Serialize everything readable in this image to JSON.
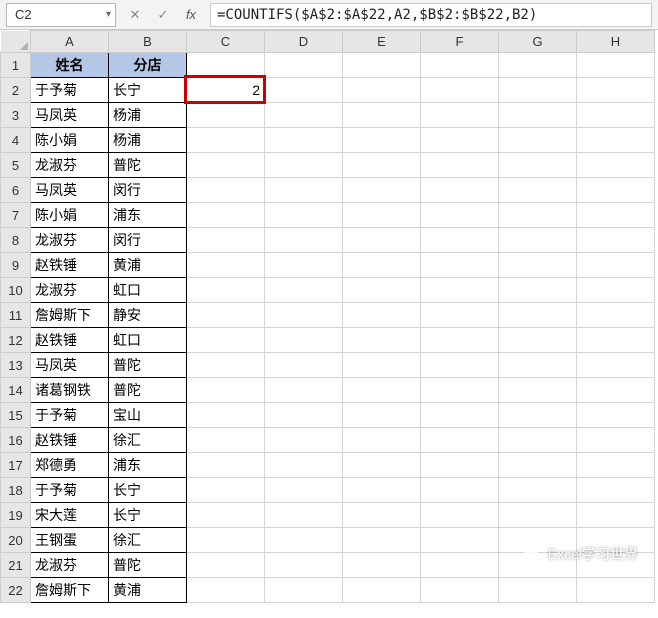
{
  "formula_bar": {
    "name_box": "C2",
    "cancel_icon": "✕",
    "confirm_icon": "✓",
    "fx_label": "fx",
    "formula": "=COUNTIFS($A$2:$A$22,A2,$B$2:$B$22,B2)"
  },
  "columns": [
    "A",
    "B",
    "C",
    "D",
    "E",
    "F",
    "G",
    "H"
  ],
  "headers": {
    "A": "姓名",
    "B": "分店"
  },
  "rows": [
    {
      "n": 1
    },
    {
      "n": 2,
      "A": "于予菊",
      "B": "长宁",
      "C": "2"
    },
    {
      "n": 3,
      "A": "马凤英",
      "B": "杨浦"
    },
    {
      "n": 4,
      "A": "陈小娟",
      "B": "杨浦"
    },
    {
      "n": 5,
      "A": "龙淑芬",
      "B": "普陀"
    },
    {
      "n": 6,
      "A": "马凤英",
      "B": "闵行"
    },
    {
      "n": 7,
      "A": "陈小娟",
      "B": "浦东"
    },
    {
      "n": 8,
      "A": "龙淑芬",
      "B": "闵行"
    },
    {
      "n": 9,
      "A": "赵铁锤",
      "B": "黄浦"
    },
    {
      "n": 10,
      "A": "龙淑芬",
      "B": "虹口"
    },
    {
      "n": 11,
      "A": "詹姆斯下",
      "B": "静安"
    },
    {
      "n": 12,
      "A": "赵铁锤",
      "B": "虹口"
    },
    {
      "n": 13,
      "A": "马凤英",
      "B": "普陀"
    },
    {
      "n": 14,
      "A": "诸葛钢铁",
      "B": "普陀"
    },
    {
      "n": 15,
      "A": "于予菊",
      "B": "宝山"
    },
    {
      "n": 16,
      "A": "赵铁锤",
      "B": "徐汇"
    },
    {
      "n": 17,
      "A": "郑德勇",
      "B": "浦东"
    },
    {
      "n": 18,
      "A": "于予菊",
      "B": "长宁"
    },
    {
      "n": 19,
      "A": "宋大莲",
      "B": "长宁"
    },
    {
      "n": 20,
      "A": "王钢蛋",
      "B": "徐汇"
    },
    {
      "n": 21,
      "A": "龙淑芬",
      "B": "普陀"
    },
    {
      "n": 22,
      "A": "詹姆斯下",
      "B": "黄浦"
    }
  ],
  "active_cell": "C2",
  "watermark": {
    "text": "Excel学习世界"
  }
}
